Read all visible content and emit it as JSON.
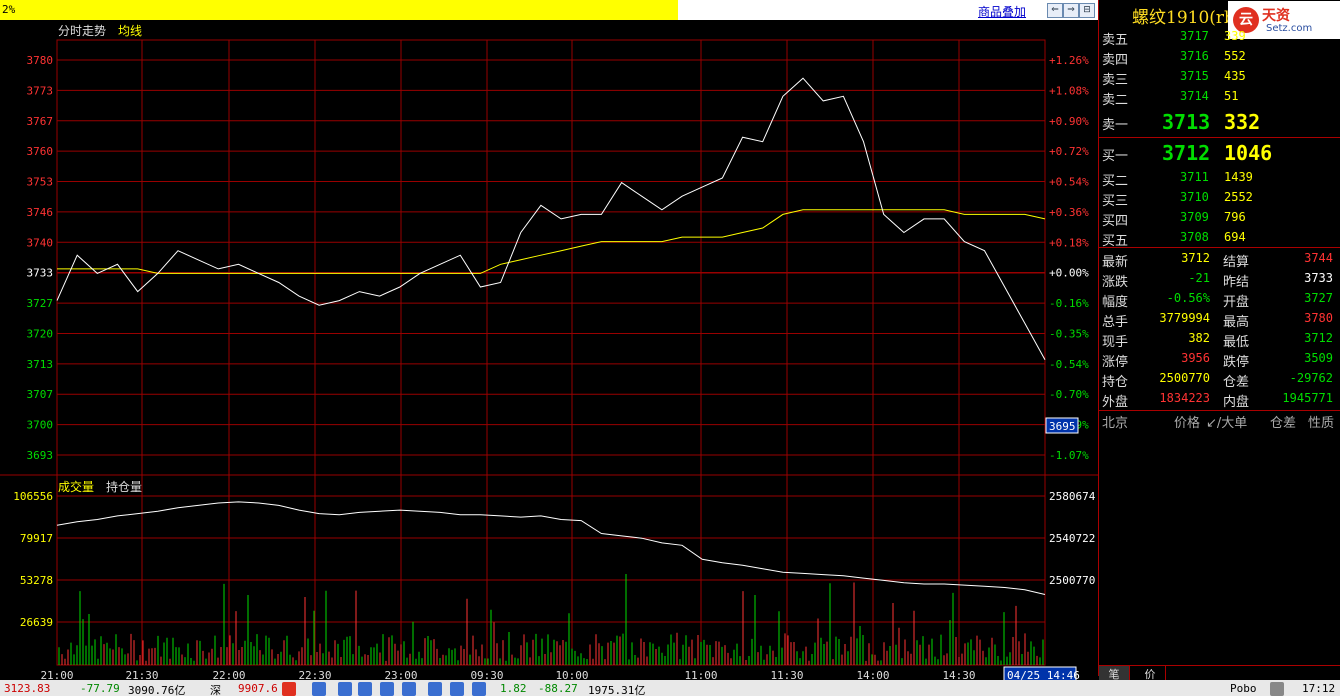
{
  "topbar": {
    "percent": "2%",
    "overlay_link": "商品叠加"
  },
  "chart": {
    "price_legend": [
      "分时走势",
      "均线"
    ],
    "volume_legend": [
      "成交量",
      "持仓量"
    ],
    "price_ticks": [
      "3780",
      "3773",
      "3767",
      "3760",
      "3753",
      "3746",
      "3740",
      "3733",
      "3727",
      "3720",
      "3713",
      "3707",
      "3700",
      "3693"
    ],
    "pct_ticks": [
      "+1.26%",
      "+1.08%",
      "+0.90%",
      "+0.72%",
      "+0.54%",
      "+0.36%",
      "+0.18%",
      "+0.00%",
      "-0.16%",
      "-0.35%",
      "-0.54%",
      "-0.70%",
      "-0.89%",
      "-1.07%"
    ],
    "cursor_price": "3695",
    "volume_ticks": [
      "106556",
      "79917",
      "53278",
      "26639"
    ],
    "oi_ticks": [
      "2580674",
      "2540722",
      "2500770"
    ],
    "time_ticks": [
      "21:00",
      "21:30",
      "22:00",
      "22:30",
      "23:00",
      "09:30",
      "10:00",
      "11:00",
      "11:30",
      "14:00",
      "14:30"
    ],
    "cursor_time": "04/25 14:46",
    "colors": {
      "price_line": "#ffffff",
      "avg_line": "#ffff00",
      "up": "#ff3333",
      "down": "#00dd00",
      "grid": "#990000"
    }
  },
  "chart_data": {
    "type": "line",
    "price_range": [
      3693,
      3780
    ],
    "base_price": 3733,
    "price_series": [
      3727,
      3737,
      3733,
      3735,
      3729,
      3733,
      3738,
      3736,
      3734,
      3735,
      3733,
      3731,
      3728,
      3726,
      3727,
      3729,
      3728,
      3730,
      3733,
      3735,
      3737,
      3730,
      3731,
      3742,
      3748,
      3745,
      3746,
      3746,
      3753,
      3750,
      3747,
      3750,
      3752,
      3754,
      3763,
      3762,
      3772,
      3776,
      3771,
      3772,
      3762,
      3746,
      3742,
      3745,
      3745,
      3740,
      3738,
      3730,
      3722,
      3714
    ],
    "avg_series": [
      3734,
      3734,
      3734,
      3734,
      3734,
      3733,
      3733,
      3733,
      3733,
      3733,
      3733,
      3733,
      3733,
      3733,
      3733,
      3733,
      3733,
      3733,
      3733,
      3733,
      3733,
      3733,
      3735,
      3736,
      3737,
      3738,
      3739,
      3740,
      3740,
      3740,
      3740,
      3741,
      3741,
      3741,
      3742,
      3743,
      3746,
      3747,
      3747,
      3747,
      3747,
      3747,
      3747,
      3747,
      3747,
      3746,
      3746,
      3746,
      3746,
      3745
    ],
    "oi_series": [
      2575,
      2578,
      2580,
      2583,
      2585,
      2587,
      2590,
      2592,
      2594,
      2595,
      2594,
      2592,
      2588,
      2585,
      2584,
      2586,
      2587,
      2588,
      2587,
      2586,
      2584,
      2584,
      2583,
      2582,
      2583,
      2580,
      2579,
      2568,
      2566,
      2564,
      2560,
      2558,
      2546,
      2543,
      2541,
      2538,
      2535,
      2534,
      2533,
      2532,
      2530,
      2528,
      2526,
      2525,
      2525,
      2524,
      2523,
      2522,
      2520,
      2516
    ],
    "oi_range": [
      2490,
      2600
    ],
    "volume_max": 106556
  },
  "side": {
    "symbol": "螺纹1910(rb1910)",
    "logo": {
      "glyph": "云",
      "name": "天资",
      "url": "Setz.com"
    },
    "asks": [
      {
        "label": "卖五",
        "price": "3717",
        "vol": "339"
      },
      {
        "label": "卖四",
        "price": "3716",
        "vol": "552"
      },
      {
        "label": "卖三",
        "price": "3715",
        "vol": "435"
      },
      {
        "label": "卖二",
        "price": "3714",
        "vol": "51"
      }
    ],
    "ask1": {
      "label": "卖一",
      "price": "3713",
      "vol": "332"
    },
    "bid1": {
      "label": "买一",
      "price": "3712",
      "vol": "1046"
    },
    "bids": [
      {
        "label": "买二",
        "price": "3711",
        "vol": "1439"
      },
      {
        "label": "买三",
        "price": "3710",
        "vol": "2552"
      },
      {
        "label": "买四",
        "price": "3709",
        "vol": "796"
      },
      {
        "label": "买五",
        "price": "3708",
        "vol": "694"
      }
    ],
    "stats": [
      {
        "l1": "最新",
        "v1": "3712",
        "c1": "#ffff00",
        "l2": "结算",
        "v2": "3744",
        "c2": "#ff3333"
      },
      {
        "l1": "涨跌",
        "v1": "-21",
        "c1": "#00dd00",
        "l2": "昨结",
        "v2": "3733",
        "c2": "#ffffff"
      },
      {
        "l1": "幅度",
        "v1": "-0.56%",
        "c1": "#00dd00",
        "l2": "开盘",
        "v2": "3727",
        "c2": "#00dd00"
      },
      {
        "l1": "总手",
        "v1": "3779994",
        "c1": "#ffff00",
        "l2": "最高",
        "v2": "3780",
        "c2": "#ff3333"
      },
      {
        "l1": "现手",
        "v1": "382",
        "c1": "#ffff00",
        "l2": "最低",
        "v2": "3712",
        "c2": "#00dd00"
      },
      {
        "l1": "涨停",
        "v1": "3956",
        "c1": "#ff3333",
        "l2": "跌停",
        "v2": "3509",
        "c2": "#00dd00"
      },
      {
        "l1": "持仓",
        "v1": "2500770",
        "c1": "#ffff00",
        "l2": "仓差",
        "v2": "-29762",
        "c2": "#00dd00"
      },
      {
        "l1": "外盘",
        "v1": "1834223",
        "c1": "#ff3333",
        "l2": "内盘",
        "v2": "1945771",
        "c2": "#00dd00"
      }
    ],
    "tick_header": [
      "北京",
      "价格",
      "↙/大单",
      "仓差",
      "性质"
    ],
    "bottom_tabs": [
      "笔",
      "价"
    ]
  },
  "status": {
    "items": [
      "3123.83",
      "-77.79",
      "3090.76亿",
      "深",
      "9907.6",
      "1.82",
      "-88.27",
      "1975.31亿",
      "Pobo",
      "17:12"
    ]
  }
}
